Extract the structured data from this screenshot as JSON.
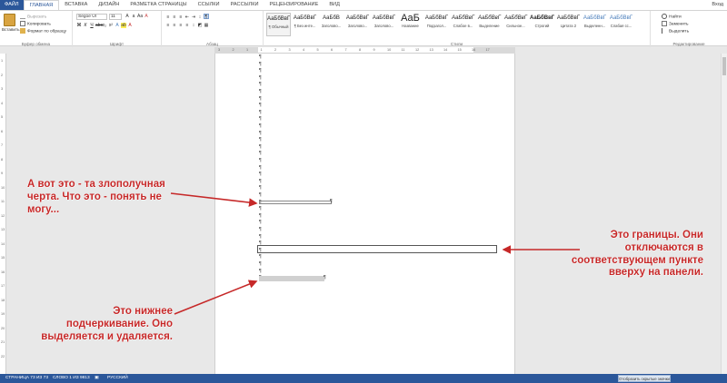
{
  "tabs": [
    {
      "label": "ФАЙЛ"
    },
    {
      "label": "ГЛАВНАЯ"
    },
    {
      "label": "ВСТАВКА"
    },
    {
      "label": "ДИЗАЙН"
    },
    {
      "label": "РАЗМЕТКА СТРАНИЦЫ"
    },
    {
      "label": "ССЫЛКИ"
    },
    {
      "label": "РАССЫЛКИ"
    },
    {
      "label": "РЕЦЕНЗИРОВАНИЕ"
    },
    {
      "label": "ВИД"
    }
  ],
  "user_label": "Вход",
  "clipboard": {
    "paste": "Вставить",
    "cut": "Вырезать",
    "copy": "Копировать",
    "format_painter": "Формат по образцу",
    "label": "Буфер обмена"
  },
  "font": {
    "name": "Segoe UI",
    "size": "11",
    "label": "Шрифт"
  },
  "paragraph": {
    "label": "Абзац"
  },
  "styles": {
    "label": "Стили",
    "items": [
      {
        "sample": "АаБбВвГ",
        "name": "¶ Обычный"
      },
      {
        "sample": "АаБбВвГ",
        "name": "¶ Без инте..."
      },
      {
        "sample": "АаБбВ",
        "name": "Заголово..."
      },
      {
        "sample": "АаБбВвГ",
        "name": "Заголово..."
      },
      {
        "sample": "АаБбВвГ",
        "name": "Заголово..."
      },
      {
        "sample": "АаБ",
        "name": "Название"
      },
      {
        "sample": "АаБбВвГ",
        "name": "Подзагол..."
      },
      {
        "sample": "АаБбВвГ",
        "name": "Слабое в..."
      },
      {
        "sample": "АаБбВвГ",
        "name": "Выделение"
      },
      {
        "sample": "АаБбВвГ",
        "name": "Сильное..."
      },
      {
        "sample": "АаБбВвГ",
        "name": "Строгий"
      },
      {
        "sample": "АаБбВвГ",
        "name": "Цитата 2"
      },
      {
        "sample": "АаБбВвГ",
        "name": "Выделенн..."
      },
      {
        "sample": "АаБбВвГ",
        "name": "Слабая сс..."
      }
    ]
  },
  "editing": {
    "find": "Найти",
    "replace": "Заменить",
    "select": "Выделить",
    "label": "Редактирование"
  },
  "ruler": {
    "numbers": [
      "3",
      "2",
      "1",
      "1",
      "2",
      "3",
      "4",
      "5",
      "6",
      "7",
      "8",
      "9",
      "10",
      "11",
      "12",
      "13",
      "14",
      "15",
      "16",
      "17"
    ]
  },
  "vruler": {
    "numbers": [
      "1",
      "2",
      "3",
      "4",
      "5",
      "6",
      "7",
      "8",
      "9",
      "10",
      "11",
      "12",
      "13",
      "14",
      "15",
      "16",
      "17",
      "18",
      "19",
      "20",
      "21",
      "22"
    ]
  },
  "pilcrow": "¶",
  "annotations": {
    "top_left": "А вот это - та злополучная черта. Что это - понять не могу...",
    "bottom_left": "Это нижнее подчеркивание. Оно выделяется и удаляется.",
    "right": "Это границы. Они отключаются в соответствующем пункте вверху на панели."
  },
  "status": {
    "page": "СТРАНИЦА 73 ИЗ 73",
    "words": "СЛОВО 1 ИЗ 9813",
    "lang": "РУССКИЙ",
    "tooltip": "Отобразить скрытые значки"
  },
  "colors": {
    "accent": "#2b579a",
    "annotation": "#c62828"
  }
}
